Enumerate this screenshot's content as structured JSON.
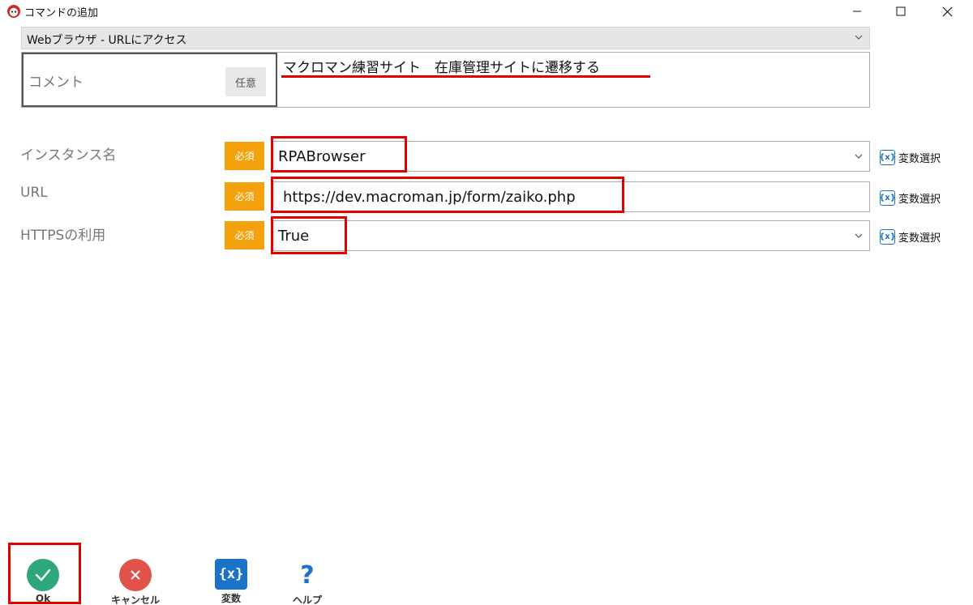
{
  "window": {
    "title": "コマンドの追加",
    "controls": [
      "minimize-icon",
      "maximize-icon",
      "close-icon"
    ]
  },
  "command": {
    "selected": "Webブラウザ - URLにアクセス"
  },
  "comment": {
    "label": "コメント",
    "badge": "任意",
    "value": "マクロマン練習サイト　在庫管理サイトに遷移する"
  },
  "fields": [
    {
      "label": "インスタンス名",
      "badge": "必須",
      "value": "RPABrowser",
      "type": "dropdown",
      "var_label": "変数選択"
    },
    {
      "label": "URL",
      "badge": "必須",
      "value": "https://dev.macroman.jp/form/zaiko.php",
      "type": "text",
      "var_label": "変数選択"
    },
    {
      "label": "HTTPSの利用",
      "badge": "必須",
      "value": "True",
      "type": "dropdown",
      "var_label": "変数選択"
    }
  ],
  "var_icon_text": "{x}",
  "toolbar": {
    "ok": "Ok",
    "cancel": "キャンセル",
    "variables": "変数",
    "help": "ヘルプ"
  },
  "colors": {
    "required_badge": "#f3a10c",
    "highlight": "#e00000",
    "ok_green": "#2ea87a",
    "cancel_red": "#e0524a",
    "var_blue": "#1a73c9"
  }
}
